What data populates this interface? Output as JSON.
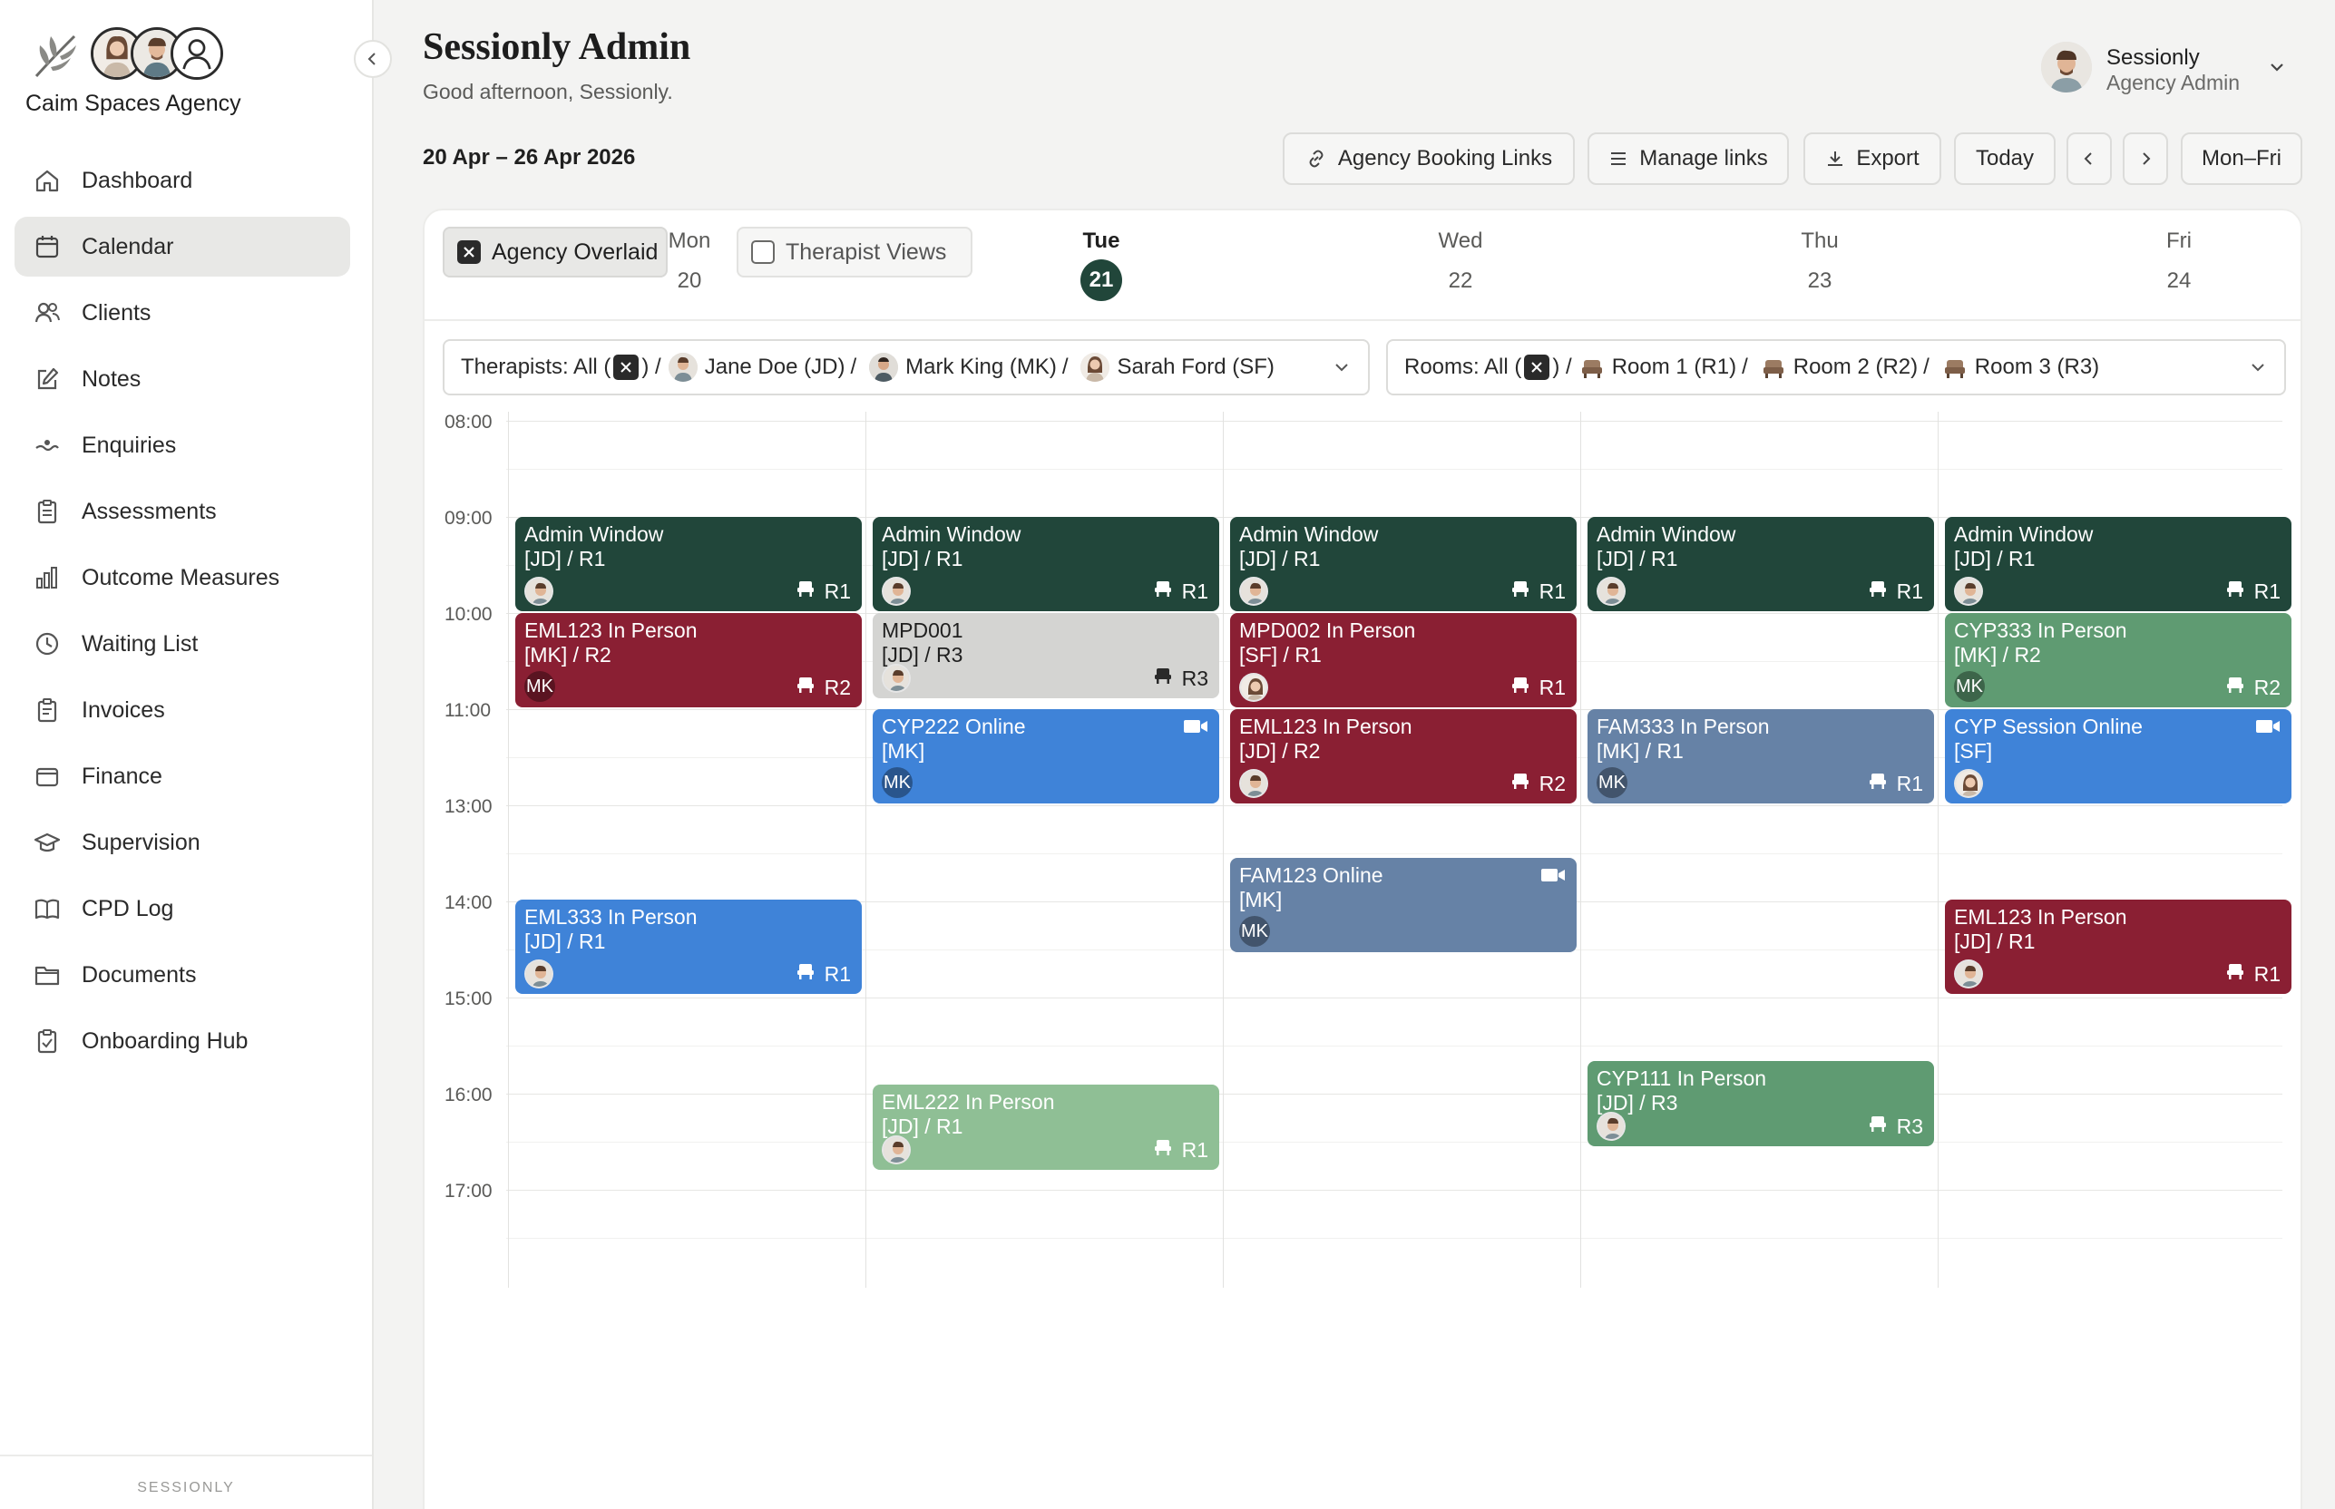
{
  "sidebar": {
    "brand_name": "Caim Spaces Agency",
    "items": [
      {
        "label": "Dashboard",
        "icon": "home-icon"
      },
      {
        "label": "Calendar",
        "icon": "calendar-icon",
        "active": true
      },
      {
        "label": "Clients",
        "icon": "users-icon"
      },
      {
        "label": "Notes",
        "icon": "edit-icon"
      },
      {
        "label": "Enquiries",
        "icon": "wave-icon"
      },
      {
        "label": "Assessments",
        "icon": "clipboard-icon"
      },
      {
        "label": "Outcome Measures",
        "icon": "bar-chart-icon"
      },
      {
        "label": "Waiting List",
        "icon": "clock-icon"
      },
      {
        "label": "Invoices",
        "icon": "receipt-icon"
      },
      {
        "label": "Finance",
        "icon": "wallet-icon"
      },
      {
        "label": "Supervision",
        "icon": "graduation-icon"
      },
      {
        "label": "CPD Log",
        "icon": "book-icon"
      },
      {
        "label": "Documents",
        "icon": "folder-icon"
      },
      {
        "label": "Onboarding Hub",
        "icon": "clipboard-check-icon"
      }
    ],
    "footer": "SESSIONLY"
  },
  "header": {
    "title": "Sessionly Admin",
    "greeting": "Good afternoon, Sessionly.",
    "user_name": "Sessionly",
    "user_role": "Agency Admin"
  },
  "toolbar": {
    "date_range": "20 Apr – 26 Apr 2026",
    "booking_links": "Agency Booking Links",
    "manage_links": "Manage links",
    "export": "Export",
    "today": "Today",
    "range_mode": "Mon–Fri"
  },
  "calendar": {
    "view_agency": "Agency Overlaid",
    "view_therapist": "Therapist Views",
    "days": [
      {
        "name": "Mon",
        "date": "20"
      },
      {
        "name": "Tue",
        "date": "21",
        "today": true
      },
      {
        "name": "Wed",
        "date": "22"
      },
      {
        "name": "Thu",
        "date": "23"
      },
      {
        "name": "Fri",
        "date": "24"
      }
    ],
    "therapist_filter": {
      "prefix": "Therapists: All (",
      "suffix": ") /",
      "items": [
        "Jane Doe (JD)",
        "Mark King (MK)",
        "Sarah Ford (SF)"
      ]
    },
    "room_filter": {
      "prefix": "Rooms: All (",
      "suffix": ") /",
      "items": [
        "Room 1 (R1)",
        "Room 2 (R2)",
        "Room 3 (R3)"
      ]
    },
    "times": [
      "08:00",
      "09:00",
      "10:00",
      "11:00",
      "13:00",
      "14:00",
      "15:00",
      "16:00",
      "17:00"
    ],
    "events": [
      {
        "day": 0,
        "title": "Admin Window",
        "sub": "[JD] / R1",
        "room": "R1",
        "color": "#21463a",
        "who": "face-jd"
      },
      {
        "day": 1,
        "title": "Admin Window",
        "sub": "[JD] / R1",
        "room": "R1",
        "color": "#21463a",
        "who": "face-jd"
      },
      {
        "day": 2,
        "title": "Admin Window",
        "sub": "[JD] / R1",
        "room": "R1",
        "color": "#21463a",
        "who": "face-jd"
      },
      {
        "day": 3,
        "title": "Admin Window",
        "sub": "[JD] / R1",
        "room": "R1",
        "color": "#21463a",
        "who": "face-jd"
      },
      {
        "day": 4,
        "title": "Admin Window",
        "sub": "[JD] / R1",
        "room": "R1",
        "color": "#21463a",
        "who": "face-jd"
      },
      {
        "day": 0,
        "title": "EML123 In Person",
        "sub": "[MK] / R2",
        "room": "R2",
        "color": "#8a1f33",
        "who": "MK"
      },
      {
        "day": 1,
        "title": "MPD001",
        "sub": "[JD] / R3",
        "room": "R3",
        "color": "#d4d4d2",
        "who": "face-jd"
      },
      {
        "day": 2,
        "title": "MPD002 In Person",
        "sub": "[SF] / R1",
        "room": "R1",
        "color": "#8a1f33",
        "who": "face-sf"
      },
      {
        "day": 4,
        "title": "CYP333 In Person",
        "sub": "[MK] / R2",
        "room": "R2",
        "color": "#5f9b72",
        "who": "MK"
      },
      {
        "day": 1,
        "title": "CYP222 Online",
        "sub": "[MK]",
        "room": "",
        "color": "#3f83d8",
        "who": "MK"
      },
      {
        "day": 2,
        "title": "EML123 In Person",
        "sub": "[JD] / R2",
        "room": "R2",
        "color": "#8a1f33",
        "who": "face-jd"
      },
      {
        "day": 3,
        "title": "FAM333 In Person",
        "sub": "[MK] / R1",
        "room": "R1",
        "color": "#6682a6",
        "who": "MK"
      },
      {
        "day": 4,
        "title": "CYP Session Online",
        "sub": "[SF]",
        "room": "",
        "color": "#3f83d8",
        "who": "face-sf"
      },
      {
        "day": 2,
        "title": "FAM123 Online",
        "sub": "[MK]",
        "room": "",
        "color": "#6682a6",
        "who": "MK"
      },
      {
        "day": 0,
        "title": "EML333 In Person",
        "sub": "[JD] / R1",
        "room": "R1",
        "color": "#3f83d8",
        "who": "face-jd"
      },
      {
        "day": 4,
        "title": "EML123 In Person",
        "sub": "[JD] / R1",
        "room": "R1",
        "color": "#8a1f33",
        "who": "face-jd"
      },
      {
        "day": 3,
        "title": "CYP111 In Person",
        "sub": "[JD] / R3",
        "room": "R3",
        "color": "#5f9b72",
        "who": "face-jd"
      },
      {
        "day": 1,
        "title": "EML222 In Person",
        "sub": "[JD] / R1",
        "room": "R1",
        "color": "#8fbf95",
        "who": "face-jd"
      }
    ]
  }
}
